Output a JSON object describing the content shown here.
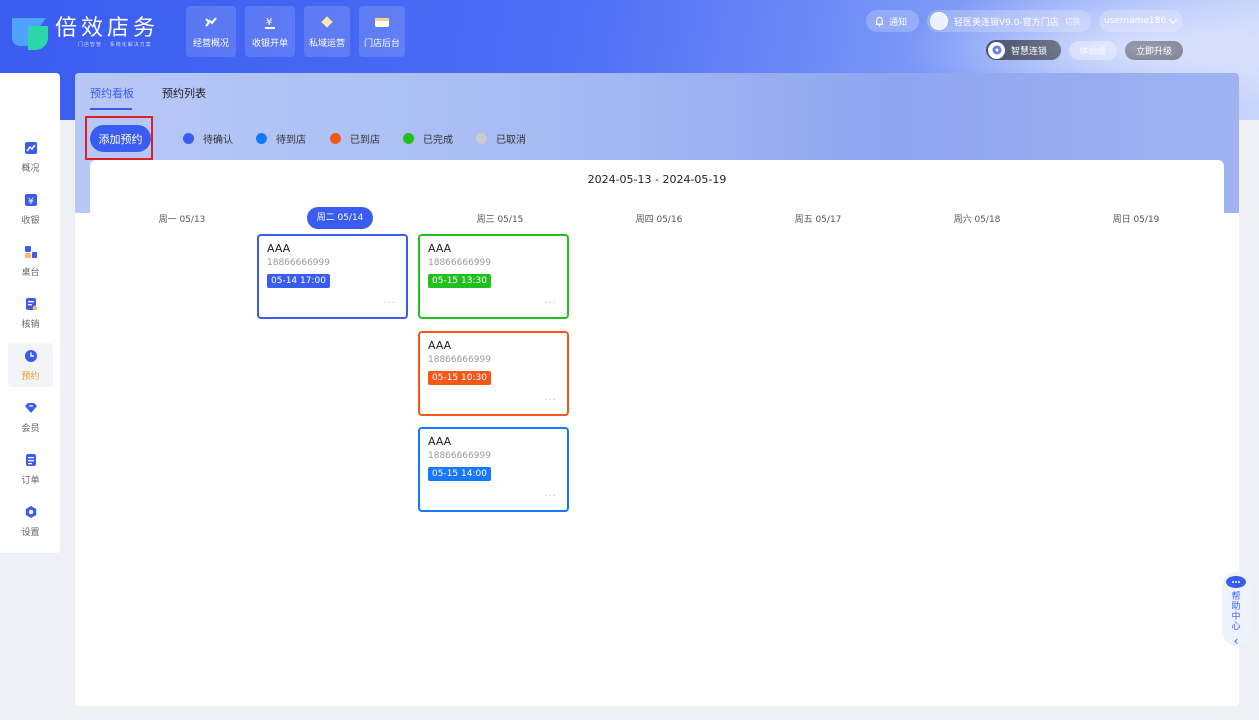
{
  "header": {
    "brand_title": "倍效店务",
    "brand_subtitle": "门店智管 · 系统化解决方案",
    "nav": [
      {
        "label": "经营概况",
        "icon": "trend-icon"
      },
      {
        "label": "收银开单",
        "icon": "cashier-icon"
      },
      {
        "label": "私域运营",
        "icon": "diamond-icon"
      },
      {
        "label": "门店后台",
        "icon": "store-icon"
      }
    ],
    "notify_label": "通知",
    "store_label": "轻医美连锁V9.0-官方门店",
    "switch_label": "切换",
    "username": "username186",
    "smart_label": "智慧连锁",
    "trial_label": "体验版",
    "upgrade_label": "立即升级"
  },
  "sidebar": {
    "items": [
      {
        "label": "概况",
        "icon": "chart-icon"
      },
      {
        "label": "收银",
        "icon": "yen-icon"
      },
      {
        "label": "桌台",
        "icon": "table-icon"
      },
      {
        "label": "核销",
        "icon": "verify-icon"
      },
      {
        "label": "预约",
        "icon": "clock-icon",
        "active": true
      },
      {
        "label": "会员",
        "icon": "diamond-icon"
      },
      {
        "label": "订单",
        "icon": "order-icon"
      },
      {
        "label": "设置",
        "icon": "settings-icon"
      }
    ]
  },
  "tabs": {
    "board": "预约看板",
    "list": "预约列表"
  },
  "add_button": "添加预约",
  "legend": [
    {
      "label": "待确认",
      "color": "#3a5cf0"
    },
    {
      "label": "待到店",
      "color": "#1677ff"
    },
    {
      "label": "已到店",
      "color": "#f5571b"
    },
    {
      "label": "已完成",
      "color": "#22c01e"
    },
    {
      "label": "已取消",
      "color": "#cccccc"
    }
  ],
  "date_range": "2024-05-13 - 2024-05-19",
  "days": [
    {
      "label": "周一 05/13"
    },
    {
      "label": "周二 05/14",
      "active": true
    },
    {
      "label": "周三 05/15"
    },
    {
      "label": "周四 05/16"
    },
    {
      "label": "周五 05/17"
    },
    {
      "label": "周六 05/18"
    },
    {
      "label": "周日 05/19"
    }
  ],
  "cards": [
    {
      "name": "AAA",
      "phone": "18866666999",
      "time": "05-14 17:00",
      "status_color": "#3a5cf0",
      "day": "周二 05/14"
    },
    {
      "name": "AAA",
      "phone": "18866666999",
      "time": "05-15 13:30",
      "status_color": "#22c01e",
      "day": "周三 05/15"
    },
    {
      "name": "AAA",
      "phone": "18866666999",
      "time": "05-15 10:30",
      "status_color": "#f5571b",
      "day": "周三 05/15"
    },
    {
      "name": "AAA",
      "phone": "18866666999",
      "time": "05-15 14:00",
      "status_color": "#1677ff",
      "day": "周三 05/15"
    }
  ],
  "help": {
    "label": "帮助中心"
  }
}
